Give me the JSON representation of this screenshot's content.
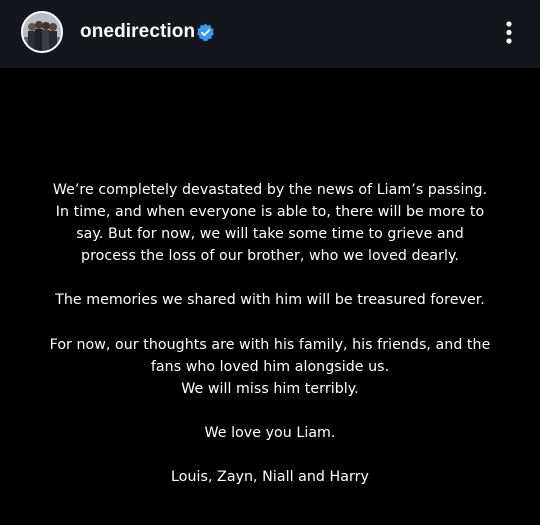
{
  "header": {
    "username": "onedirection",
    "verified_badge": "verified-badge-icon",
    "more_icon": "more-vertical-icon",
    "accent_color": "#3897f0"
  },
  "post": {
    "background_color": "#000000",
    "text_color": "#ffffff",
    "paragraphs": [
      {
        "lines": [
          "We’re completely devastated by the news of Liam’s passing.",
          "In time, and when everyone is able to, there will be more to",
          "say. But for now, we will take some time to grieve and",
          "process the loss of our brother, who we loved dearly."
        ]
      },
      {
        "lines": [
          "The memories we shared with him will be treasured forever."
        ]
      },
      {
        "lines": [
          "For now, our thoughts are with his family, his friends, and the",
          "fans who loved him alongside us.",
          "We will miss him terribly."
        ]
      },
      {
        "lines": [
          "We love you Liam."
        ]
      },
      {
        "lines": [
          "Louis, Zayn, Niall and Harry"
        ]
      }
    ]
  }
}
